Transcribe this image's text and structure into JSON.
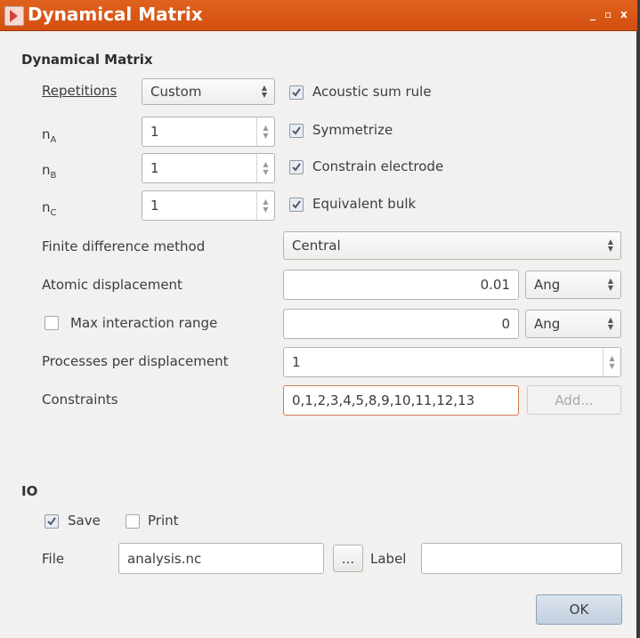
{
  "window": {
    "title": "Dynamical Matrix",
    "minimize_glyph": "_",
    "maximize_glyph": "▫",
    "close_glyph": "x"
  },
  "dynamical_matrix": {
    "section_title": "Dynamical Matrix",
    "repetitions": {
      "label": "Repetitions",
      "value": "Custom"
    },
    "n_a": {
      "label": "n",
      "sub": "A",
      "value": "1"
    },
    "n_b": {
      "label": "n",
      "sub": "B",
      "value": "1"
    },
    "n_c": {
      "label": "n",
      "sub": "C",
      "value": "1"
    },
    "acoustic_sum_rule": {
      "label": "Acoustic sum rule",
      "checked": true
    },
    "symmetrize": {
      "label": "Symmetrize",
      "checked": true
    },
    "constrain_electrode": {
      "label": "Constrain electrode",
      "checked": true
    },
    "equivalent_bulk": {
      "label": "Equivalent bulk",
      "checked": true
    },
    "finite_difference": {
      "label": "Finite difference method",
      "value": "Central"
    },
    "atomic_displacement": {
      "label": "Atomic displacement",
      "value": "0.01",
      "unit": "Ang"
    },
    "max_interaction_range": {
      "label": "Max interaction range",
      "checked": false,
      "value": "0",
      "unit": "Ang"
    },
    "processes_per_displacement": {
      "label": "Processes per displacement",
      "value": "1"
    },
    "constraints": {
      "label": "Constraints",
      "value": "0,1,2,3,4,5,8,9,10,11,12,13",
      "add_label": "Add..."
    }
  },
  "io": {
    "section_title": "IO",
    "save": {
      "label": "Save",
      "checked": true
    },
    "print": {
      "label": "Print",
      "checked": false
    },
    "file": {
      "label": "File",
      "value": "analysis.nc",
      "browse_label": "..."
    },
    "label_field": {
      "label": "Label",
      "value": ""
    }
  },
  "ok_label": "OK"
}
